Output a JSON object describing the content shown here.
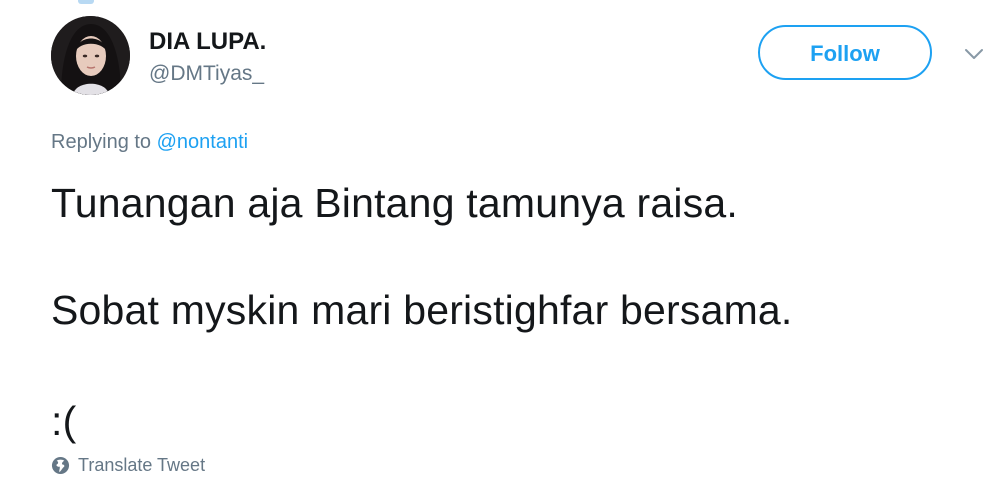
{
  "user": {
    "display_name": "DIA LUPA.",
    "handle": "@DMTiyas_"
  },
  "actions": {
    "follow_label": "Follow",
    "menu_icon": "chevron-down-icon"
  },
  "reply": {
    "prefix": "Replying to",
    "mention": "@nontanti"
  },
  "tweet": {
    "lines": [
      "Tunangan aja Bintang tamunya raisa.",
      "Sobat myskin mari beristighfar bersama.",
      ":("
    ]
  },
  "translate": {
    "icon": "globe-icon",
    "label": "Translate Tweet"
  },
  "colors": {
    "accent": "#1da1f2",
    "text": "#14171a",
    "muted": "#657786"
  }
}
